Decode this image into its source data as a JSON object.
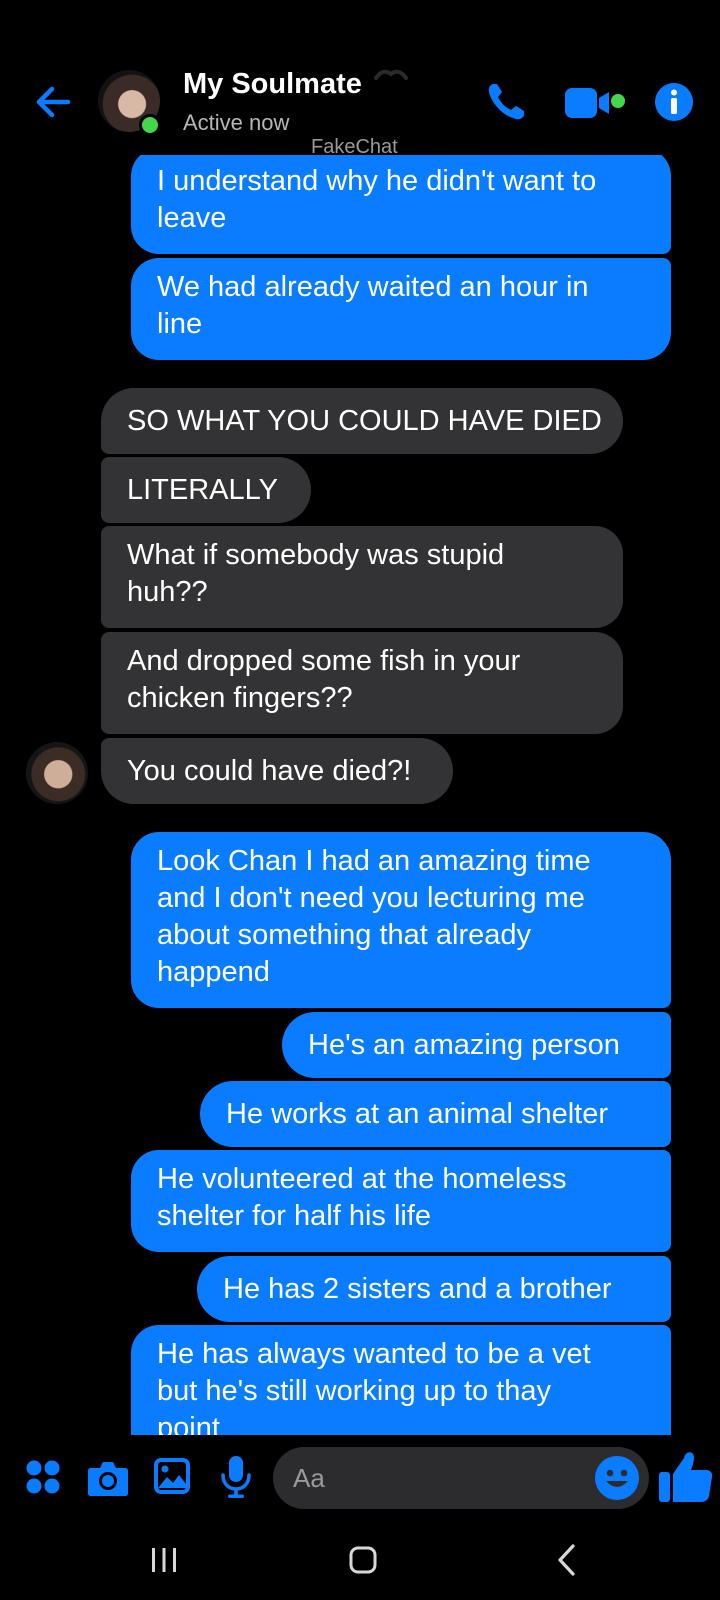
{
  "header": {
    "contact_name": "My Soulmate",
    "status": "Active now",
    "watermark": "FakeChat",
    "icons": [
      "back-arrow-icon",
      "phone-icon",
      "video-camera-icon",
      "info-icon"
    ]
  },
  "colors": {
    "accent": "#0a7cff",
    "incoming_bubble": "#333335",
    "online": "#44d64b",
    "background": "#000000"
  },
  "messages": [
    {
      "direction": "out",
      "lines": [
        "I understand why he didn't want to",
        "leave"
      ]
    },
    {
      "direction": "out",
      "lines": [
        "We had already waited an hour in",
        "line"
      ]
    },
    {
      "direction": "in",
      "lines": [
        "SO WHAT YOU COULD HAVE DIED"
      ]
    },
    {
      "direction": "in",
      "lines": [
        "LITERALLY"
      ]
    },
    {
      "direction": "in",
      "lines": [
        "What if somebody was stupid",
        "huh??"
      ]
    },
    {
      "direction": "in",
      "lines": [
        "And dropped some fish in your",
        "chicken fingers??"
      ]
    },
    {
      "direction": "in",
      "lines": [
        "You could have died?!"
      ]
    },
    {
      "direction": "out",
      "lines": [
        "Look Chan I had an amazing time",
        "and I don't need you lecturing me",
        "about something that already",
        "happend"
      ]
    },
    {
      "direction": "out",
      "lines": [
        "He's an amazing person"
      ]
    },
    {
      "direction": "out",
      "lines": [
        "He works at an animal shelter"
      ]
    },
    {
      "direction": "out",
      "lines": [
        "He volunteered at the homeless",
        "shelter for half his life"
      ]
    },
    {
      "direction": "out",
      "lines": [
        "He has 2 sisters and a brother"
      ]
    },
    {
      "direction": "out",
      "lines": [
        "He has always wanted to be a vet",
        "but he's still working up to thay",
        "point"
      ]
    }
  ],
  "composer": {
    "placeholder": "Aa",
    "icons": [
      "apps-icon",
      "camera-icon",
      "gallery-icon",
      "microphone-icon",
      "emoji-icon",
      "thumbs-up-icon"
    ]
  },
  "navbar": {
    "icons": [
      "recent-apps-icon",
      "home-icon",
      "back-icon"
    ]
  }
}
